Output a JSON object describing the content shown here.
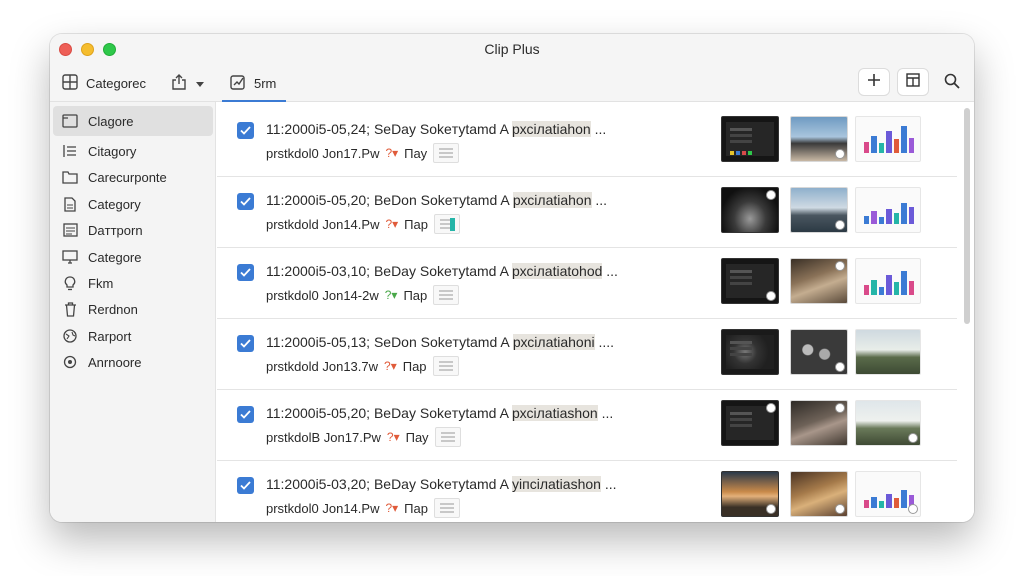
{
  "window": {
    "title": "Clip Plus"
  },
  "toolbar": {
    "categories_label": "Categoreс",
    "active_tab_label": "5rm"
  },
  "sidebar": {
    "items": [
      {
        "label": "Clagore",
        "icon": "folder-icon",
        "selected": true
      },
      {
        "label": "Citagory",
        "icon": "list-icon",
        "selected": false
      },
      {
        "label": "Carecurponte",
        "icon": "folder-outline-icon",
        "selected": false
      },
      {
        "label": "Category",
        "icon": "document-icon",
        "selected": false
      },
      {
        "label": "Daттporn",
        "icon": "image-icon",
        "selected": false
      },
      {
        "label": "Categore",
        "icon": "monitor-icon",
        "selected": false
      },
      {
        "label": "Fkm",
        "icon": "bulb-icon",
        "selected": false
      },
      {
        "label": "Rerdnon",
        "icon": "trash-icon",
        "selected": false
      },
      {
        "label": "Rarport",
        "icon": "globe-icon",
        "selected": false
      },
      {
        "label": "Anrnoore",
        "icon": "target-icon",
        "selected": false
      }
    ]
  },
  "clips": [
    {
      "line1": "11:2000i5-05,24;  SeDay Sokeтуtamd A",
      "line1_highlight": "рхсілаtiаhon",
      "line1_tail": " ...",
      "line2": "prstkdol0 Jon17.Pw",
      "line2_tail": "Пау",
      "checked": true
    },
    {
      "line1": "11:2000i5-05,20;  BeDon Sokeтуtamd A",
      "line1_highlight": "рхсілаtiаhon",
      "line1_tail": " ...",
      "line2": "prstkdold Jon14.Pw",
      "line2_tail": "Пар",
      "checked": true
    },
    {
      "line1": "11:2000i5-03,10;  BeDay Sokeтуtamd A",
      "line1_highlight": "рхсілаtiаtohod",
      "line1_tail": " ...",
      "line2": "prstkdol0 Jon14-2w",
      "line2_tail": "Пар",
      "checked": true
    },
    {
      "line1": "11:2000i5-05,13;  SeDon Sokeтуtamd A",
      "line1_highlight": "рхсілаtiаhonі",
      "line1_tail": " ....",
      "line2": "prstkdold Jon13.7w",
      "line2_tail": "Пар",
      "checked": true
    },
    {
      "line1": "11:2000i5-05,20;  BeDay Sokeтуtamd A",
      "line1_highlight": "рхсілаtiаshon",
      "line1_tail": " ...",
      "line2": "prstkdolB Jon17.Pw",
      "line2_tail": "Пау",
      "checked": true
    },
    {
      "line1": "11:2000i5-03,20;  BeDay Sokeтуtamd A",
      "line1_highlight": "уіпсілаtiаshon",
      "line1_tail": " ...",
      "line2": "prstkdol0 Jon14.Pw",
      "line2_tail": "Пар",
      "checked": true
    }
  ],
  "colors": {
    "accent": "#3b7bd4",
    "checkbox": "#3b7bd4"
  }
}
